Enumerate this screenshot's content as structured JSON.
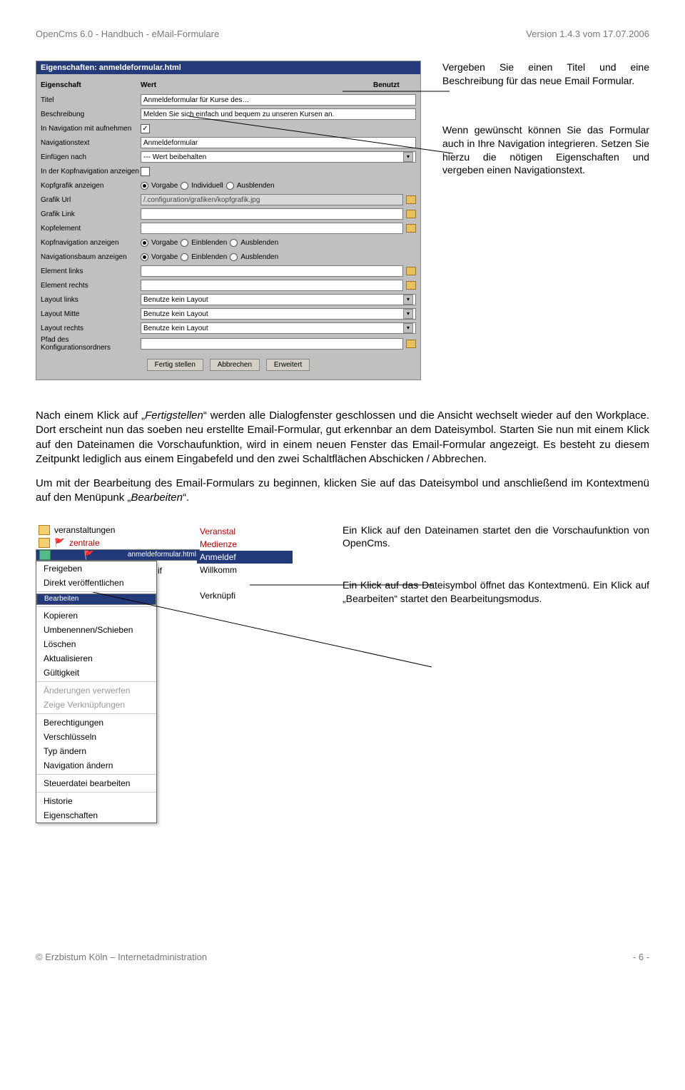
{
  "header": {
    "left": "OpenCms 6.0 - Handbuch - eMail-Formulare",
    "right": "Version 1.4.3 vom 17.07.2006"
  },
  "dialog": {
    "title": "Eigenschaften: anmeldeformular.html",
    "head": {
      "c1": "Eigenschaft",
      "c2": "Wert",
      "c3": "Benutzt"
    },
    "rows": {
      "titel": {
        "label": "Titel",
        "value": "Anmeldeformular für Kurse des…"
      },
      "beschreibung": {
        "label": "Beschreibung",
        "value": "Melden Sie sich einfach und bequem zu unseren Kursen an."
      },
      "nav": {
        "label": "In Navigation mit aufnehmen"
      },
      "navtext": {
        "label": "Navigationstext",
        "value": "Anmeldeformular"
      },
      "einfuegen": {
        "label": "Einfügen nach",
        "value": "--- Wert beibehalten"
      },
      "kopfnav": {
        "label": "In der Kopfnavigation anzeigen"
      },
      "kopfgrafik": {
        "label": "Kopfgrafik anzeigen",
        "r1": "Vorgabe",
        "r2": "Individuell",
        "r3": "Ausblenden"
      },
      "grafikurl": {
        "label": "Grafik Url",
        "value": "/.configuration/grafiken/kopfgrafik.jpg"
      },
      "grafiklink": {
        "label": "Grafik Link"
      },
      "kopfelement": {
        "label": "Kopfelement"
      },
      "kopfnavanz": {
        "label": "Kopfnavigation anzeigen",
        "r1": "Vorgabe",
        "r2": "Einblenden",
        "r3": "Ausblenden"
      },
      "navbaum": {
        "label": "Navigationsbaum anzeigen",
        "r1": "Vorgabe",
        "r2": "Einblenden",
        "r3": "Ausblenden"
      },
      "ellinks": {
        "label": "Element links"
      },
      "elrechts": {
        "label": "Element rechts"
      },
      "laylinks": {
        "label": "Layout links",
        "value": "Benutze kein Layout"
      },
      "laymitte": {
        "label": "Layout Mitte",
        "value": "Benutze kein Layout"
      },
      "layrechts": {
        "label": "Layout rechts",
        "value": "Benutze kein Layout"
      },
      "pfad": {
        "label": "Pfad des Konfigurationsordners"
      }
    },
    "buttons": {
      "b1": "Fertig stellen",
      "b2": "Abbrechen",
      "b3": "Erweitert"
    }
  },
  "callouts": {
    "c1": "Vergeben Sie einen Titel und eine Beschreibung für das neue Email Formular.",
    "c2": "Wenn gewünscht können Sie das Formular auch in Ihre Navigation integrieren. Setzen Sie hierzu die nötigen Eigenschaften und vergeben einen Navigationstext."
  },
  "body": {
    "p1a": "Nach einem Klick auf „",
    "p1i": "Fertigstellen",
    "p1b": "“ werden alle Dialogfenster geschlossen und die Ansicht wechselt wieder auf den Workplace. Dort erscheint nun das soeben neu erstellte Email-Formular, gut erkennbar an dem Dateisymbol. Starten Sie nun mit einem Klick auf den Dateinamen die Vorschaufunktion, wird in einem neuen Fenster das Email-Formular angezeigt. Es besteht zu diesem Zeitpunkt lediglich aus einem Eingabefeld und den zwei Schaltflächen Abschicken / Abbrechen.",
    "p2a": "Um mit der Bearbeitung des Email-Formulars zu beginnen, klicken Sie auf das Dateisymbol und anschließend im Kontextmenü auf den Menüpunk „",
    "p2i": "Bearbeiten",
    "p2b": "“."
  },
  "explorer": {
    "r1": "veranstaltungen",
    "r2": "zentrale",
    "r3": "anmeldeformular.html",
    "t1": "Veranstal",
    "t2": "Medienze",
    "t3": "Anmeldef",
    "t4": "Willkomm",
    "t5": "Verknüpfi"
  },
  "ifsuffix": "if",
  "ctxmenu": {
    "m1": "Freigeben",
    "m2": "Direkt veröffentlichen",
    "m3": "Bearbeiten",
    "m4": "Kopieren",
    "m5": "Umbenennen/Schieben",
    "m6": "Löschen",
    "m7": "Aktualisieren",
    "m8": "Gültigkeit",
    "m9": "Änderungen verwerfen",
    "m10": "Zeige Verknüpfungen",
    "m11": "Berechtigungen",
    "m12": "Verschlüsseln",
    "m13": "Typ ändern",
    "m14": "Navigation ändern",
    "m15": "Steuerdatei bearbeiten",
    "m16": "Historie",
    "m17": "Eigenschaften"
  },
  "midcallouts": {
    "c1": "Ein Klick auf den Dateinamen startet den die Vorschaufunktion von OpenCms.",
    "c2": "Ein Klick auf das Dateisymbol öffnet das Kontextmenü. Ein Klick auf „Bearbeiten“ startet den Bearbeitungsmodus."
  },
  "footer": {
    "left": "© Erzbistum Köln – Internetadministration",
    "right": "- 6 -"
  }
}
